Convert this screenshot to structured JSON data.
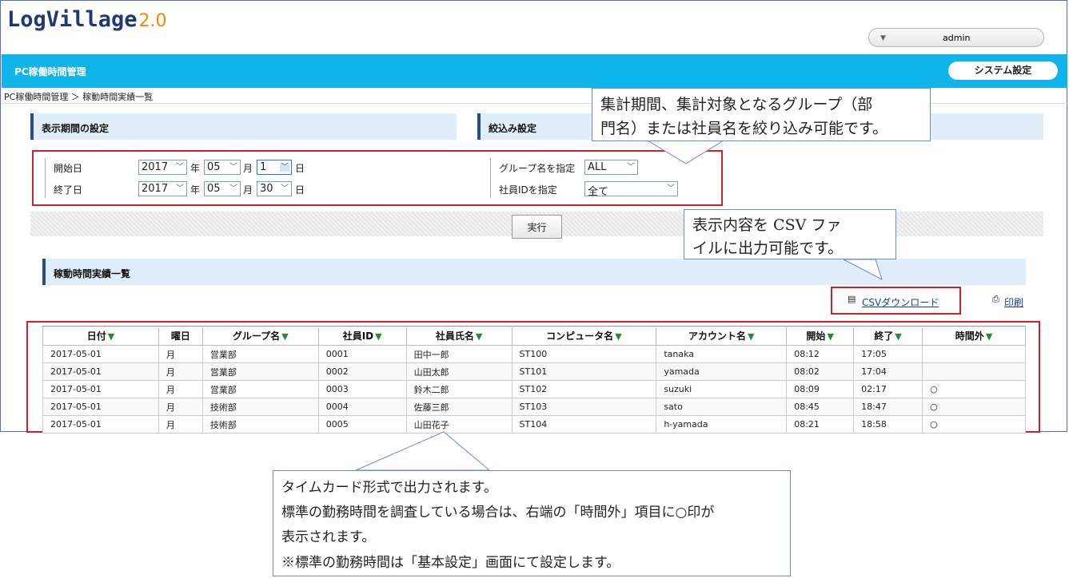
{
  "app": {
    "logo_text": "LogVillage",
    "logo_version": "2.0",
    "user_name": "admin"
  },
  "header": {
    "title": "PC稼働時間管理",
    "system_settings": "システム設定"
  },
  "breadcrumb": "PC稼働時間管理 ＞ 稼動時間実績一覧",
  "period_section": {
    "title": "表示期間の設定",
    "start_label": "開始日",
    "end_label": "終了日",
    "start": {
      "year": "2017",
      "month": "05",
      "day": "1"
    },
    "end": {
      "year": "2017",
      "month": "05",
      "day": "30"
    },
    "year_unit": "年",
    "month_unit": "月",
    "day_unit": "日"
  },
  "filter_section": {
    "title": "絞込み設定",
    "group_label": "グループ名を指定",
    "group_value": "ALL",
    "employee_label": "社員IDを指定",
    "employee_value": "全て"
  },
  "run_button": "実行",
  "results_section": {
    "title": "稼動時間実績一覧",
    "csv_download": "CSVダウンロード",
    "print": "印刷"
  },
  "table": {
    "columns": [
      "日付",
      "曜日",
      "グループ名",
      "社員ID",
      "社員氏名",
      "コンピュータ名",
      "アカウント名",
      "開始",
      "終了",
      "時間外"
    ],
    "rows": [
      [
        "2017-05-01",
        "月",
        "営業部",
        "0001",
        "田中一郎",
        "ST100",
        "tanaka",
        "08:12",
        "17:05",
        ""
      ],
      [
        "2017-05-01",
        "月",
        "営業部",
        "0002",
        "山田太郎",
        "ST101",
        "yamada",
        "08:02",
        "17:04",
        ""
      ],
      [
        "2017-05-01",
        "月",
        "営業部",
        "0003",
        "鈴木二郎",
        "ST102",
        "suzuki",
        "08:09",
        "02:17",
        "○"
      ],
      [
        "2017-05-01",
        "月",
        "技術部",
        "0004",
        "佐藤三郎",
        "ST103",
        "sato",
        "08:45",
        "18:47",
        "○"
      ],
      [
        "2017-05-01",
        "月",
        "技術部",
        "0005",
        "山田花子",
        "ST104",
        "h-yamada",
        "08:21",
        "18:58",
        "○"
      ]
    ]
  },
  "callouts": {
    "filter_note_1": "集計期間、集計対象となるグループ（部",
    "filter_note_2": "門名）または社員名を絞り込み可能です。",
    "csv_note_1": "表示内容を CSV ファ",
    "csv_note_2": "イルに出力可能です。",
    "table_note_1": "タイムカード形式で出力されます。",
    "table_note_2": "標準の勤務時間を調査している場合は、右端の「時間外」項目に○印が",
    "table_note_3": "表示されます。",
    "table_note_4": "※標準の勤務時間は「基本設定」画面にて設定します。"
  },
  "colors": {
    "header_bar": "#0fb4ea",
    "highlight_border": "#d0202a",
    "section_bg": "#dfeefa",
    "sort_arrow": "#1f8c2f"
  }
}
